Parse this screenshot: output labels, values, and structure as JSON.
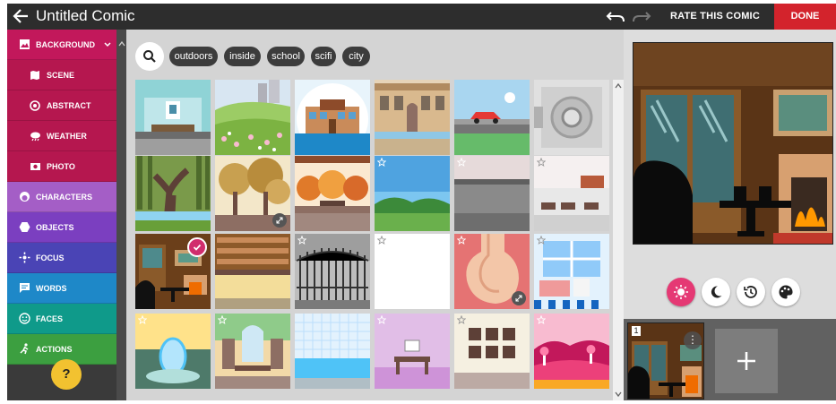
{
  "header": {
    "title": "Untitled Comic",
    "rate_label": "RATE THIS COMIC",
    "done_label": "DONE"
  },
  "sidebar": {
    "background": "BACKGROUND",
    "scene": "SCENE",
    "abstract": "ABSTRACT",
    "weather": "WEATHER",
    "photo": "PHOTO",
    "characters": "CHARACTERS",
    "objects": "OBJECTS",
    "focus": "FOCUS",
    "words": "WORDS",
    "faces": "FACES",
    "actions": "ACTIONS",
    "help": "?"
  },
  "filters": {
    "chips": [
      "outdoors",
      "inside",
      "school",
      "scifi",
      "city"
    ]
  },
  "gallery": {
    "selected_index": 12,
    "rows": 4,
    "columns": 6
  },
  "panels": {
    "first_number": "1",
    "menu": "⋮",
    "add": "+"
  },
  "colors": {
    "accent": "#d3232c",
    "background_item": "#c2185b",
    "background_sub": "#b5174f",
    "characters": "#a45ec6",
    "objects": "#7b3fc0",
    "focus": "#4a44b5",
    "words": "#1e88c8",
    "faces": "#0f9a8a",
    "actions": "#3c9f40"
  }
}
